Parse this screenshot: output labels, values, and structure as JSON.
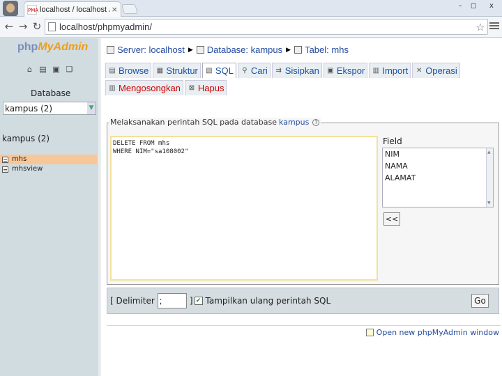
{
  "browser": {
    "tab_title": "localhost / localhost / kampus",
    "favicon_text": "PMA",
    "url": "localhost/phpmyadmin/",
    "controls": [
      "–",
      "◻",
      "x"
    ]
  },
  "sidebar": {
    "logo_php": "php",
    "logo_myadmin": "MyAdmin",
    "database_label": "Database",
    "database_select": "kampus (2)",
    "db_heading": "kampus (2)",
    "tables": [
      {
        "name": "mhs",
        "active": true
      },
      {
        "name": "mhsview",
        "active": false
      }
    ]
  },
  "breadcrumb": {
    "server": "Server: localhost",
    "database": "Database: kampus",
    "table": "Tabel: mhs"
  },
  "tabs": [
    {
      "label": "Browse",
      "icon": "browse-icon"
    },
    {
      "label": "Struktur",
      "icon": "structure-icon"
    },
    {
      "label": "SQL",
      "icon": "sql-icon",
      "active": true
    },
    {
      "label": "Cari",
      "icon": "search-icon"
    },
    {
      "label": "Sisipkan",
      "icon": "insert-icon"
    },
    {
      "label": "Ekspor",
      "icon": "export-icon"
    },
    {
      "label": "Import",
      "icon": "import-icon"
    },
    {
      "label": "Operasi",
      "icon": "operations-icon"
    }
  ],
  "tabs2": [
    {
      "label": "Mengosongkan",
      "icon": "empty-icon"
    },
    {
      "label": "Hapus",
      "icon": "drop-icon"
    }
  ],
  "sql": {
    "legend": "Melaksanakan perintah SQL pada database",
    "db_link": "kampus",
    "query": "DELETE FROM mhs\nWHERE NIM=\"sa108002\"",
    "field_label": "Field",
    "fields": [
      "NIM",
      "NAMA",
      "ALAMAT"
    ],
    "insert_button": "<<"
  },
  "options": {
    "delimiter_label": "[ Delimiter",
    "delimiter_value": ";",
    "bracket_close": "]",
    "show_query_checked": true,
    "show_query_label": "Tampilkan ulang perintah SQL",
    "go_button": "Go"
  },
  "footer": {
    "new_window_link": "Open new phpMyAdmin window"
  }
}
